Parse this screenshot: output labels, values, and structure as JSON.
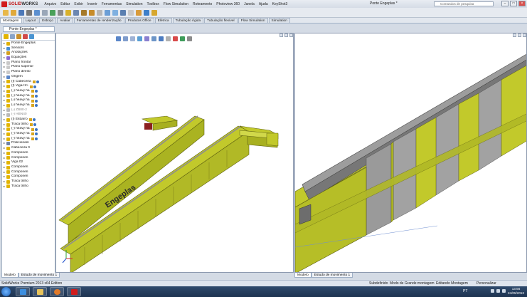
{
  "app": {
    "brand_part1": "SOLID",
    "brand_part2": "WORKS",
    "document_title": "Ponte Engeplas *",
    "search_placeholder": "Comandos de pesquisa"
  },
  "menu": [
    "Arquivo",
    "Editar",
    "Exibir",
    "Inserir",
    "Ferramentas",
    "Simulation",
    "Toolbox",
    "Flow Simulation",
    "Roteamento",
    "Photoview 360",
    "Janela",
    "Ajuda",
    "KeyShot3"
  ],
  "command_tabs": [
    {
      "label": "Montagem",
      "active": true
    },
    {
      "label": "Layout"
    },
    {
      "label": "Esboço"
    },
    {
      "label": "Avaliar"
    },
    {
      "label": "Ferramentas de renderização"
    },
    {
      "label": "Produtos Office"
    },
    {
      "label": "Elétrica"
    },
    {
      "label": "Tubulação rígida"
    },
    {
      "label": "Tubulação flexível"
    },
    {
      "label": "Flow Simulation"
    },
    {
      "label": "Simulation"
    }
  ],
  "feature_tree": {
    "doc_tab": "Ponte Engeplas *",
    "items": [
      {
        "label": "Ponte Engeplas",
        "icon": "assembly-icon",
        "color": "#e0b000"
      },
      {
        "label": "Sensors",
        "icon": "sensor-icon",
        "color": "#4a8ed4"
      },
      {
        "label": "Anotações",
        "icon": "annotation-icon",
        "color": "#d4a020"
      },
      {
        "label": "Equações",
        "icon": "equation-icon",
        "color": "#8a6bd4"
      },
      {
        "label": "Plano frontal",
        "icon": "plane-icon",
        "color": "#c9c9c9"
      },
      {
        "label": "Plano superior",
        "icon": "plane-icon",
        "color": "#c9c9c9"
      },
      {
        "label": "Plano direito",
        "icon": "plane-icon",
        "color": "#c9c9c9"
      },
      {
        "label": "Origem",
        "icon": "origin-icon",
        "color": "#5a86c9"
      },
      {
        "label": "(f) Cabeceira",
        "icon": "part-icon",
        "color": "#e2b400",
        "mate": true
      },
      {
        "label": "(f) Viga<1>",
        "icon": "part-icon",
        "color": "#e2b400",
        "mate": true
      },
      {
        "label": "(-) heavy ha",
        "icon": "part-icon",
        "color": "#e2b400",
        "mate": true
      },
      {
        "label": "(-) heavy ha",
        "icon": "part-icon",
        "color": "#e2b400",
        "mate": true
      },
      {
        "label": "(-) heavy ha",
        "icon": "part-icon",
        "color": "#e2b400",
        "mate": true
      },
      {
        "label": "(-) heavy ha",
        "icon": "part-icon",
        "color": "#e2b400",
        "mate": true
      },
      {
        "label": "(-) ZB80-2",
        "icon": "part-icon",
        "color": "#b9b9b9",
        "suppressed": true
      },
      {
        "label": "(-) HBN40",
        "icon": "part-icon",
        "color": "#b9b9b9",
        "suppressed": true
      },
      {
        "label": "(f) Esbarro",
        "icon": "part-icon",
        "color": "#e2b400",
        "mate": true
      },
      {
        "label": "Traca trilho",
        "icon": "part-icon",
        "color": "#e2b400",
        "mate": true
      },
      {
        "label": "(-) heavy ha",
        "icon": "part-icon",
        "color": "#e2b400",
        "mate": true
      },
      {
        "label": "(-) heavy ha",
        "icon": "part-icon",
        "color": "#e2b400",
        "mate": true
      },
      {
        "label": "(-) heavy ha",
        "icon": "part-icon",
        "color": "#e2b400",
        "mate": true
      },
      {
        "label": "Posicionam",
        "icon": "mate-icon",
        "color": "#6f84a6"
      },
      {
        "label": "Cabeceira 0",
        "icon": "part-icon",
        "color": "#e2b400"
      },
      {
        "label": "Componen",
        "icon": "part-icon",
        "color": "#e2b400"
      },
      {
        "label": "Componen",
        "icon": "part-icon",
        "color": "#e2b400"
      },
      {
        "label": "Viga 02",
        "icon": "part-icon",
        "color": "#e2b400"
      },
      {
        "label": "Componen",
        "icon": "part-icon",
        "color": "#e2b400"
      },
      {
        "label": "Componen",
        "icon": "part-icon",
        "color": "#e2b400"
      },
      {
        "label": "Componen",
        "icon": "part-icon",
        "color": "#e2b400"
      },
      {
        "label": "Traca trilho",
        "icon": "part-icon",
        "color": "#e2b400"
      },
      {
        "label": "Traca trilho",
        "icon": "part-icon",
        "color": "#e2b400"
      }
    ]
  },
  "bottom_tabs_left": [
    {
      "label": "Modelo",
      "active": true
    },
    {
      "label": "Estudo de movimento 1"
    }
  ],
  "bottom_tabs_right": [
    {
      "label": "Modelo",
      "active": true
    },
    {
      "label": "Estudo de movimento 1"
    }
  ],
  "model": {
    "logo_text": "Engeplas",
    "beam_color": "#c2c92b",
    "beam_dark": "#8f941c",
    "rail_color": "#8d8d8d"
  },
  "status": {
    "app_version": "SolidWorks Premium 2013 x64 Edition",
    "definition": "Subdefinido",
    "mode": "Modo de Grande montagem",
    "editing": "Editando Montagem",
    "customize": "Personalizar"
  },
  "taskbar": {
    "lang": "PT",
    "time": "13:56",
    "date": "24/05/2013"
  }
}
